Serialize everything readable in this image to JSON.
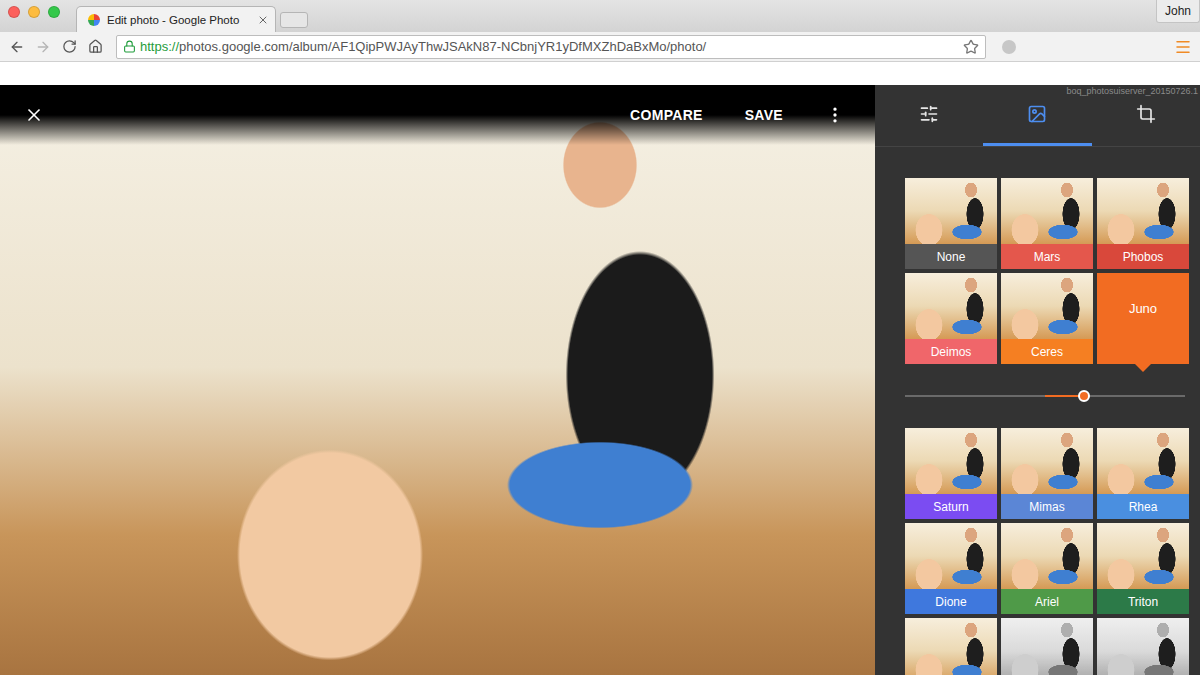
{
  "window": {
    "title": "Edit photo - Google Photo",
    "user": "John"
  },
  "address_bar": {
    "scheme": "https://",
    "rest": "photos.google.com/album/AF1QipPWJAyThwJSAkN87-NCbnjYR1yDfMXZhDaBxMo/photo/",
    "secure": true
  },
  "editor": {
    "actions": [
      "COMPARE",
      "SAVE"
    ],
    "server_label": "boq_photosuiserver_20150726.1"
  },
  "panel_tabs": [
    {
      "kind": "adjust",
      "selected": false
    },
    {
      "kind": "filters",
      "selected": true
    },
    {
      "kind": "crop",
      "selected": false
    }
  ],
  "filters": [
    {
      "label": "None",
      "color": "#555555",
      "selected": false
    },
    {
      "label": "Mars",
      "color": "#e4574c",
      "selected": false
    },
    {
      "label": "Phobos",
      "color": "#d9483b",
      "selected": false
    },
    {
      "label": "Deimos",
      "color": "#f0666a",
      "selected": false
    },
    {
      "label": "Ceres",
      "color": "#f57f22",
      "selected": false
    },
    {
      "label": "Juno",
      "color": "#f26c22",
      "selected": true
    }
  ],
  "intensity": {
    "level": 0.64
  },
  "more_filters": [
    {
      "label": "Saturn",
      "color": "#7b4cf2",
      "selected": false
    },
    {
      "label": "Mimas",
      "color": "#5b86d6",
      "selected": false
    },
    {
      "label": "Rhea",
      "color": "#4a8fe0",
      "selected": false
    },
    {
      "label": "Dione",
      "color": "#3f78dd",
      "selected": false
    },
    {
      "label": "Ariel",
      "color": "#4f9a48",
      "selected": false
    },
    {
      "label": "Triton",
      "color": "#2c7a48",
      "selected": false
    }
  ],
  "partial_row": [
    {
      "grayscale": false
    },
    {
      "grayscale": true
    },
    {
      "grayscale": true
    }
  ]
}
